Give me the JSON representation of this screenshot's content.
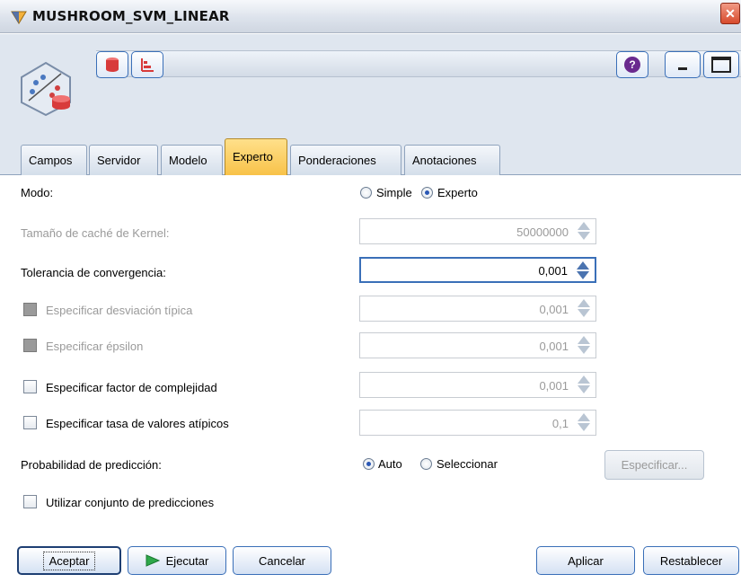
{
  "window": {
    "title": "MUSHROOM_SVM_LINEAR",
    "close_glyph": "✕"
  },
  "toolbar": {
    "help_glyph": "?",
    "icons": [
      "database-icon",
      "chart-icon",
      "help-icon",
      "minimize-icon",
      "maximize-icon"
    ]
  },
  "tabs": [
    {
      "label": "Campos",
      "active": false
    },
    {
      "label": "Servidor",
      "active": false
    },
    {
      "label": "Modelo",
      "active": false
    },
    {
      "label": "Experto",
      "active": true
    },
    {
      "label": "Ponderaciones",
      "active": false
    },
    {
      "label": "Anotaciones",
      "active": false
    }
  ],
  "form": {
    "modo": {
      "label": "Modo:",
      "options": [
        "Simple",
        "Experto"
      ],
      "selected": "Experto"
    },
    "kernel_cache": {
      "label": "Tamaño de caché de Kernel:",
      "value": "50000000",
      "enabled": false
    },
    "tolerancia": {
      "label": "Tolerancia de convergencia:",
      "value": "0,001",
      "enabled": true
    },
    "desviacion": {
      "label": "Especificar desviación típica",
      "value": "0,001",
      "checked": false,
      "enabled": false
    },
    "epsilon": {
      "label": "Especificar épsilon",
      "value": "0,001",
      "checked": false,
      "enabled": false
    },
    "complejidad": {
      "label": "Especificar factor de complejidad",
      "value": "0,001",
      "checked": false,
      "enabled": true
    },
    "atipicos": {
      "label": "Especificar tasa de valores atípicos",
      "value": "0,1",
      "checked": false,
      "enabled": true
    },
    "probabilidad": {
      "label": "Probabilidad de predicción:",
      "options": [
        "Auto",
        "Seleccionar"
      ],
      "selected": "Auto",
      "specify_button": "Especificar..."
    },
    "conjunto": {
      "label": "Utilizar conjunto de predicciones",
      "checked": false
    }
  },
  "buttons": {
    "aceptar": "Aceptar",
    "ejecutar": "Ejecutar",
    "cancelar": "Cancelar",
    "aplicar": "Aplicar",
    "restablecer": "Restablecer"
  },
  "colors": {
    "accent": "#3a6fb8",
    "active_tab": "#f8c249",
    "run_green": "#2ea84a"
  }
}
